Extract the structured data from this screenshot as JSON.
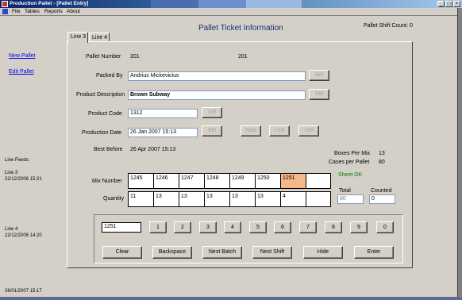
{
  "window": {
    "title": "Production Pallet - [Pallet Entry]"
  },
  "menu": [
    "File",
    "Tables",
    "Reports",
    "About"
  ],
  "header": {
    "title": "Pallet Ticket Information",
    "shift_count": "Pallet Shift Count: 0"
  },
  "left_links": {
    "new_pallet": "New Pallet",
    "edit_pallet": "Edit Pallet"
  },
  "line_feeds": {
    "label": "Line Feeds:",
    "entries": [
      {
        "line": "Line 3",
        "time": "22/12/2006 15:21"
      },
      {
        "line": "Line 4",
        "time": "22/12/2006 14:20"
      }
    ],
    "footer_time": "26/01/2007 15:17"
  },
  "tabs": [
    "Line 3",
    "Line 4"
  ],
  "form": {
    "pallet_number_label": "Pallet Number",
    "pallet_number_a": "201",
    "pallet_number_b": "201",
    "packed_by_label": "Packed By",
    "packed_by_value": "Andrius Mickevicius",
    "product_description_label": "Product Description",
    "product_description_value": "Brown Subway",
    "product_code_label": "Product Code",
    "product_code_value": "1312",
    "production_date_label": "Production Date",
    "production_date_value": "26 Jan 2007 15:13",
    "best_before_label": "Best Before",
    "best_before_value": "26 Apr 2007 15:13",
    "sel_label": "Sel",
    "now_label": "Now",
    "plus1h_label": "+1H",
    "plus2h_label": "+2H"
  },
  "stats": {
    "boxes_per_mix_label": "Boxes Per Mix",
    "boxes_per_mix_value": "13",
    "cases_per_pallet_label": "Cases per Pallet",
    "cases_per_pallet_value": "80",
    "sheet_status": "Sheet OK",
    "total_label": "Total",
    "total_value": "80",
    "counted_label": "Counted",
    "counted_value": "0",
    "status_color": "#008000"
  },
  "mix": {
    "mix_label": "Mix Number",
    "quantity_label": "Quantity",
    "mix_numbers": [
      "1245",
      "1246",
      "1247",
      "1248",
      "1249",
      "1250",
      "1251",
      ""
    ],
    "quantities": [
      "11",
      "13",
      "13",
      "13",
      "13",
      "13",
      "4",
      ""
    ],
    "highlight_color": "#f5b889"
  },
  "keypad": {
    "entry_value": "1251",
    "digits": [
      "1",
      "2",
      "3",
      "4",
      "5",
      "6",
      "7",
      "8",
      "9",
      "0"
    ],
    "actions": [
      "Clear",
      "Backspace",
      "Next Batch",
      "Next Shift",
      "Hide",
      "Enter"
    ]
  }
}
